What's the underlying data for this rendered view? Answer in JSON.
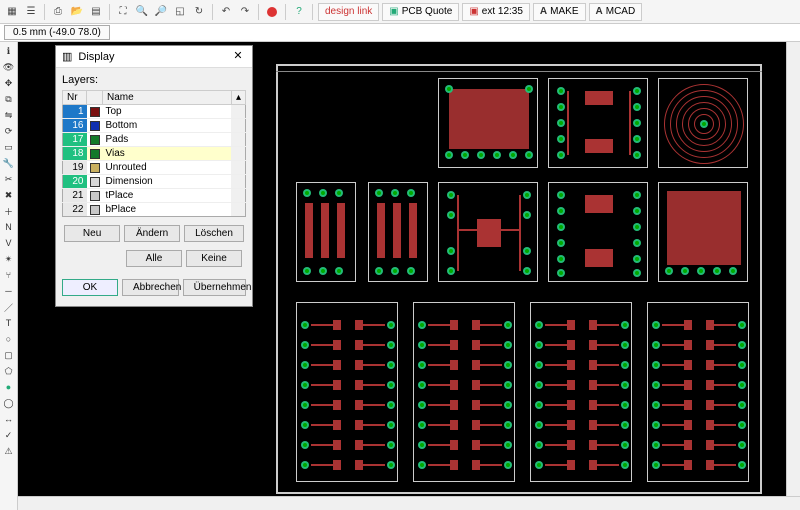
{
  "toolbar": {
    "items_left": [
      "grid",
      "layers",
      "print",
      "open",
      "save",
      "lib",
      "zoom-fit",
      "zoom-in",
      "zoom-out",
      "zoom-sel",
      "redraw",
      "undo",
      "redo"
    ],
    "btn_stop": "●",
    "btn_help": "?",
    "btn_design": "design link",
    "btn_pcb": "PCB Quote",
    "btn_bom": "ext 12:35",
    "btn_make": "MAKE",
    "btn_mcad": "MCAD"
  },
  "status": {
    "tab": "0.5 mm (-49.0 78.0)"
  },
  "dialog": {
    "title": "Display",
    "layers_label": "Layers:",
    "col_nr": "Nr",
    "col_name": "Name",
    "rows": [
      {
        "nr": "1",
        "bg": "#1e78c8",
        "sw": "#7a1010",
        "name": "Top"
      },
      {
        "nr": "16",
        "bg": "#1e78c8",
        "sw": "#1030b0",
        "name": "Bottom"
      },
      {
        "nr": "17",
        "bg": "#20c080",
        "sw": "#147a2a",
        "name": "Pads"
      },
      {
        "nr": "18",
        "bg": "#20c080",
        "sw": "#147a2a",
        "name": "Vias",
        "sel": true
      },
      {
        "nr": "19",
        "bg": "#e8e8e8",
        "sw": "#c9b060",
        "name": "Unrouted"
      },
      {
        "nr": "20",
        "bg": "#20c080",
        "sw": "#d8d8d8",
        "name": "Dimension"
      },
      {
        "nr": "21",
        "bg": "#e8e8e8",
        "sw": "#c8c8c8",
        "name": "tPlace"
      },
      {
        "nr": "22",
        "bg": "#e8e8e8",
        "sw": "#c8c8c8",
        "name": "bPlace"
      }
    ],
    "btn_neu": "Neu",
    "btn_aendern": "Ändern",
    "btn_loeschen": "Löschen",
    "btn_alle": "Alle",
    "btn_keine": "Keine",
    "btn_ok": "OK",
    "btn_abbrechen": "Abbrechen",
    "btn_uebernehmen": "Übernehmen"
  },
  "left_tools": [
    "info",
    "show",
    "move",
    "copy",
    "mirror",
    "rotate",
    "group",
    "change",
    "cut",
    "delete",
    "add",
    "name",
    "value",
    "smash",
    "miter",
    "split",
    "route",
    "ripup",
    "wire",
    "text",
    "circle",
    "arc",
    "rect",
    "poly",
    "via",
    "hole",
    "dim",
    "mark",
    "drc",
    "errors"
  ]
}
